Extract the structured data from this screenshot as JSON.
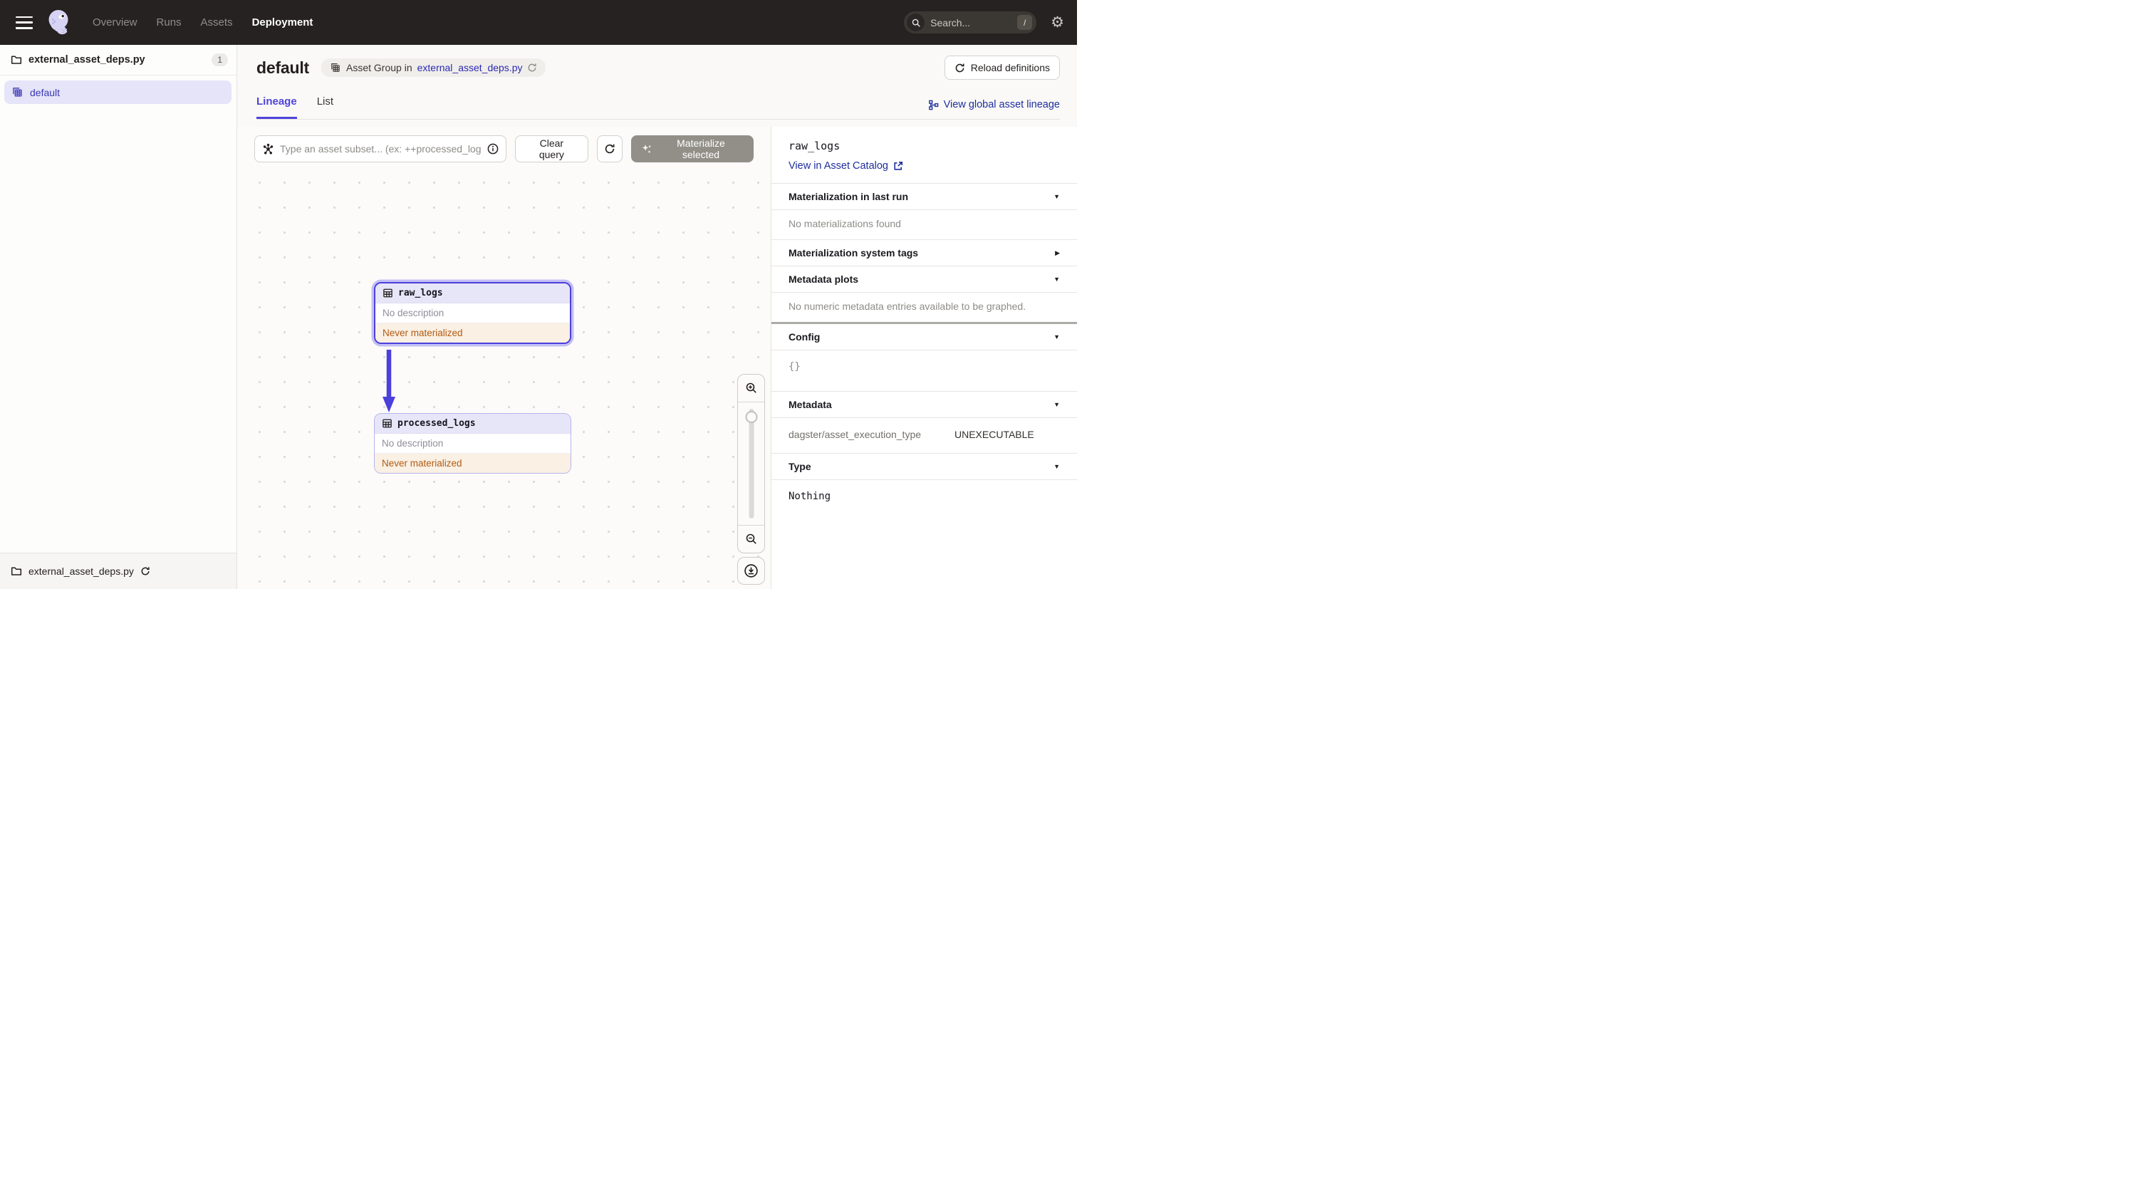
{
  "topnav": {
    "menu_items": [
      {
        "label": "Overview",
        "active": false
      },
      {
        "label": "Runs",
        "active": false
      },
      {
        "label": "Assets",
        "active": false
      },
      {
        "label": "Deployment",
        "active": true
      }
    ],
    "search": {
      "placeholder": "Search...",
      "shortcut_key": "/"
    }
  },
  "sidebar": {
    "file": {
      "label": "external_asset_deps.py",
      "count": "1"
    },
    "groups": [
      {
        "label": "default",
        "selected": true
      }
    ],
    "footer": {
      "label": "external_asset_deps.py"
    }
  },
  "header": {
    "title": "default",
    "badge": {
      "prefix": "Asset Group in",
      "link": "external_asset_deps.py"
    },
    "reload_button": "Reload definitions",
    "tabs": [
      {
        "label": "Lineage",
        "active": true
      },
      {
        "label": "List",
        "active": false
      }
    ],
    "global_lineage_link": "View global asset lineage"
  },
  "toolbar": {
    "query_placeholder": "Type an asset subset... (ex: ++processed_logs",
    "clear_button": "Clear query",
    "materialize_button": "Materialize selected"
  },
  "graph": {
    "nodes": [
      {
        "name": "raw_logs",
        "description": "No description",
        "status": "Never materialized",
        "selected": true
      },
      {
        "name": "processed_logs",
        "description": "No description",
        "status": "Never materialized",
        "selected": false
      }
    ],
    "edges": [
      {
        "from": "raw_logs",
        "to": "processed_logs"
      }
    ]
  },
  "panel": {
    "title": "raw_logs",
    "catalog_link": "View in Asset Catalog",
    "sections": [
      {
        "label": "Materialization in last run",
        "caret": "down",
        "body": "No materializations found"
      },
      {
        "label": "Materialization system tags",
        "caret": "right"
      },
      {
        "label": "Metadata plots",
        "caret": "down",
        "body": "No numeric metadata entries available to be graphed."
      },
      {
        "label": "Config",
        "caret": "down",
        "body": "{}"
      },
      {
        "label": "Metadata",
        "caret": "down",
        "row": {
          "key": "dagster/asset_execution_type",
          "value": "UNEXECUTABLE"
        }
      },
      {
        "label": "Type",
        "caret": "down",
        "body": "Nothing"
      }
    ]
  },
  "colors": {
    "accent": "#4F43DD",
    "link": "#1E2F9E",
    "topnav_bg": "#262221",
    "selected_row_bg": "#E5E4F8",
    "node_header_bg": "#E7E6F8",
    "status_warning_bg": "#FAF0E3",
    "status_warning_text": "#B15B15",
    "disabled_button_bg": "#918F88"
  }
}
